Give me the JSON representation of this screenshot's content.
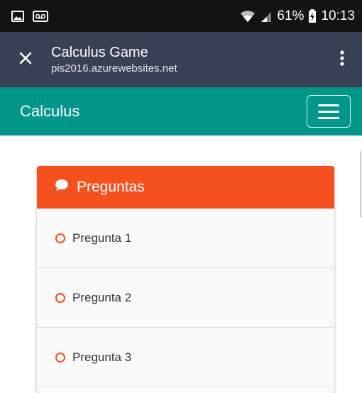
{
  "status_bar": {
    "battery": "61%",
    "time": "10:13",
    "icons": [
      "image-icon",
      "voicemail-icon",
      "wifi-icon",
      "signal-icon",
      "battery-charging-icon"
    ]
  },
  "browser": {
    "title": "Calculus Game",
    "url": "pis2016.azurewebsites.net",
    "icons": [
      "close-icon",
      "more-vert-icon"
    ]
  },
  "navbar": {
    "brand": "Calculus",
    "icons": [
      "hamburger-menu-icon"
    ]
  },
  "panel": {
    "heading": "Preguntas",
    "heading_icon": "comments-icon",
    "items": [
      {
        "label": "Pregunta 1"
      },
      {
        "label": "Pregunta 2"
      },
      {
        "label": "Pregunta 3"
      }
    ]
  },
  "colors": {
    "status_bar": "#121212",
    "browser_bar": "#374054",
    "navbar": "#009688",
    "panel_heading": "#f4511e",
    "item_icon": "#f4511e"
  }
}
